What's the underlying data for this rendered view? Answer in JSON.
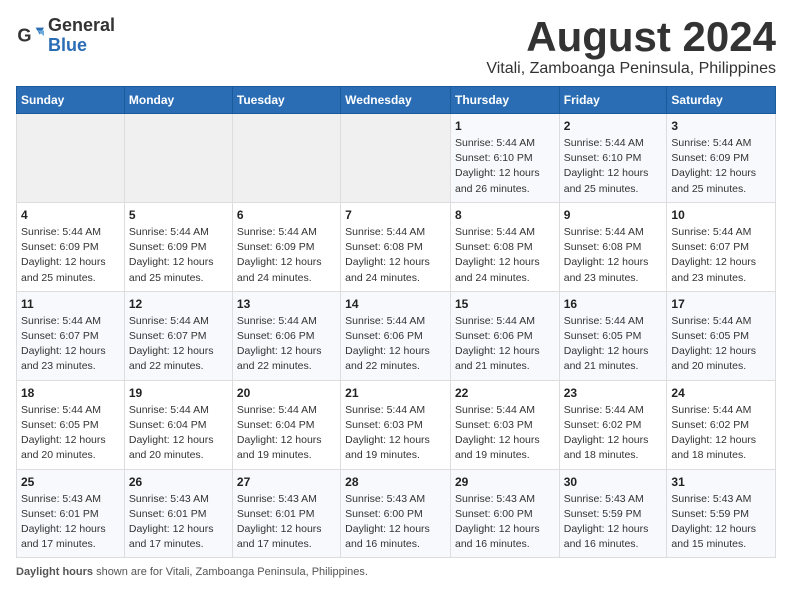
{
  "header": {
    "logo_general": "General",
    "logo_blue": "Blue",
    "title_month": "August 2024",
    "title_location": "Vitali, Zamboanga Peninsula, Philippines"
  },
  "weekdays": [
    "Sunday",
    "Monday",
    "Tuesday",
    "Wednesday",
    "Thursday",
    "Friday",
    "Saturday"
  ],
  "weeks": [
    [
      {
        "day": "",
        "info": ""
      },
      {
        "day": "",
        "info": ""
      },
      {
        "day": "",
        "info": ""
      },
      {
        "day": "",
        "info": ""
      },
      {
        "day": "1",
        "info": "Sunrise: 5:44 AM\nSunset: 6:10 PM\nDaylight: 12 hours and 26 minutes."
      },
      {
        "day": "2",
        "info": "Sunrise: 5:44 AM\nSunset: 6:10 PM\nDaylight: 12 hours and 25 minutes."
      },
      {
        "day": "3",
        "info": "Sunrise: 5:44 AM\nSunset: 6:09 PM\nDaylight: 12 hours and 25 minutes."
      }
    ],
    [
      {
        "day": "4",
        "info": "Sunrise: 5:44 AM\nSunset: 6:09 PM\nDaylight: 12 hours and 25 minutes."
      },
      {
        "day": "5",
        "info": "Sunrise: 5:44 AM\nSunset: 6:09 PM\nDaylight: 12 hours and 25 minutes."
      },
      {
        "day": "6",
        "info": "Sunrise: 5:44 AM\nSunset: 6:09 PM\nDaylight: 12 hours and 24 minutes."
      },
      {
        "day": "7",
        "info": "Sunrise: 5:44 AM\nSunset: 6:08 PM\nDaylight: 12 hours and 24 minutes."
      },
      {
        "day": "8",
        "info": "Sunrise: 5:44 AM\nSunset: 6:08 PM\nDaylight: 12 hours and 24 minutes."
      },
      {
        "day": "9",
        "info": "Sunrise: 5:44 AM\nSunset: 6:08 PM\nDaylight: 12 hours and 23 minutes."
      },
      {
        "day": "10",
        "info": "Sunrise: 5:44 AM\nSunset: 6:07 PM\nDaylight: 12 hours and 23 minutes."
      }
    ],
    [
      {
        "day": "11",
        "info": "Sunrise: 5:44 AM\nSunset: 6:07 PM\nDaylight: 12 hours and 23 minutes."
      },
      {
        "day": "12",
        "info": "Sunrise: 5:44 AM\nSunset: 6:07 PM\nDaylight: 12 hours and 22 minutes."
      },
      {
        "day": "13",
        "info": "Sunrise: 5:44 AM\nSunset: 6:06 PM\nDaylight: 12 hours and 22 minutes."
      },
      {
        "day": "14",
        "info": "Sunrise: 5:44 AM\nSunset: 6:06 PM\nDaylight: 12 hours and 22 minutes."
      },
      {
        "day": "15",
        "info": "Sunrise: 5:44 AM\nSunset: 6:06 PM\nDaylight: 12 hours and 21 minutes."
      },
      {
        "day": "16",
        "info": "Sunrise: 5:44 AM\nSunset: 6:05 PM\nDaylight: 12 hours and 21 minutes."
      },
      {
        "day": "17",
        "info": "Sunrise: 5:44 AM\nSunset: 6:05 PM\nDaylight: 12 hours and 20 minutes."
      }
    ],
    [
      {
        "day": "18",
        "info": "Sunrise: 5:44 AM\nSunset: 6:05 PM\nDaylight: 12 hours and 20 minutes."
      },
      {
        "day": "19",
        "info": "Sunrise: 5:44 AM\nSunset: 6:04 PM\nDaylight: 12 hours and 20 minutes."
      },
      {
        "day": "20",
        "info": "Sunrise: 5:44 AM\nSunset: 6:04 PM\nDaylight: 12 hours and 19 minutes."
      },
      {
        "day": "21",
        "info": "Sunrise: 5:44 AM\nSunset: 6:03 PM\nDaylight: 12 hours and 19 minutes."
      },
      {
        "day": "22",
        "info": "Sunrise: 5:44 AM\nSunset: 6:03 PM\nDaylight: 12 hours and 19 minutes."
      },
      {
        "day": "23",
        "info": "Sunrise: 5:44 AM\nSunset: 6:02 PM\nDaylight: 12 hours and 18 minutes."
      },
      {
        "day": "24",
        "info": "Sunrise: 5:44 AM\nSunset: 6:02 PM\nDaylight: 12 hours and 18 minutes."
      }
    ],
    [
      {
        "day": "25",
        "info": "Sunrise: 5:43 AM\nSunset: 6:01 PM\nDaylight: 12 hours and 17 minutes."
      },
      {
        "day": "26",
        "info": "Sunrise: 5:43 AM\nSunset: 6:01 PM\nDaylight: 12 hours and 17 minutes."
      },
      {
        "day": "27",
        "info": "Sunrise: 5:43 AM\nSunset: 6:01 PM\nDaylight: 12 hours and 17 minutes."
      },
      {
        "day": "28",
        "info": "Sunrise: 5:43 AM\nSunset: 6:00 PM\nDaylight: 12 hours and 16 minutes."
      },
      {
        "day": "29",
        "info": "Sunrise: 5:43 AM\nSunset: 6:00 PM\nDaylight: 12 hours and 16 minutes."
      },
      {
        "day": "30",
        "info": "Sunrise: 5:43 AM\nSunset: 5:59 PM\nDaylight: 12 hours and 16 minutes."
      },
      {
        "day": "31",
        "info": "Sunrise: 5:43 AM\nSunset: 5:59 PM\nDaylight: 12 hours and 15 minutes."
      }
    ]
  ],
  "footer": {
    "label": "Daylight hours",
    "text": " shown are for Vitali, Zamboanga Peninsula, Philippines."
  }
}
